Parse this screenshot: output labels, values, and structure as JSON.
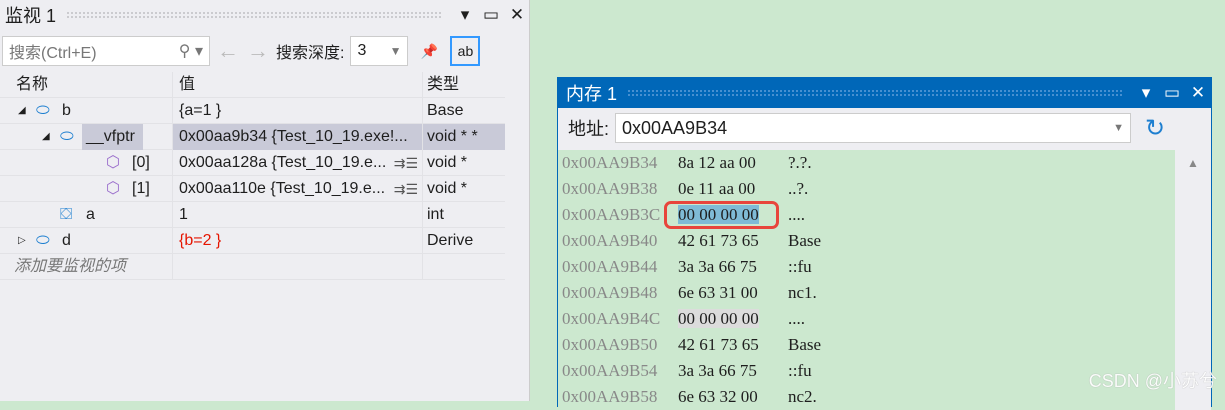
{
  "watch": {
    "title": "监视 1",
    "search_placeholder": "搜索(Ctrl+E)",
    "depth_label": "搜索深度:",
    "depth_value": "3",
    "columns": [
      "名称",
      "值",
      "类型"
    ],
    "rows": [
      {
        "name": "b",
        "value": "{a=1 }",
        "type": "Base",
        "indent": 0,
        "expander": "expanded",
        "icon": "class-icon"
      },
      {
        "name": "__vfptr",
        "value": "0x00aa9b34 {Test_10_19.exe!...",
        "type": "void * *",
        "indent": 1,
        "expander": "expanded",
        "icon": "class-icon",
        "selected": true
      },
      {
        "name": "[0]",
        "value": "0x00aa128a {Test_10_19.e...",
        "type": "void *",
        "indent": 2,
        "icon": "cube-icon",
        "visualizer": true
      },
      {
        "name": "[1]",
        "value": "0x00aa110e {Test_10_19.e...",
        "type": "void *",
        "indent": 2,
        "icon": "cube-icon",
        "visualizer": true
      },
      {
        "name": "a",
        "value": "1",
        "type": "int",
        "indent": 1,
        "icon": "field-icon"
      },
      {
        "name": "d",
        "value": "{b=2 }",
        "type": "Derive",
        "indent": 0,
        "expander": "collapsed",
        "icon": "class-icon",
        "changed": true
      }
    ],
    "add_item": "添加要监视的项"
  },
  "memory": {
    "title": "内存 1",
    "address_label": "地址:",
    "address_value": "0x00AA9B34",
    "rows": [
      {
        "addr": "0x00AA9B34",
        "bytes": "8a 12 aa 00",
        "text": "?.?."
      },
      {
        "addr": "0x00AA9B38",
        "bytes": "0e 11 aa 00",
        "text": "..?."
      },
      {
        "addr": "0x00AA9B3C",
        "bytes": "00 00 00 00",
        "text": "....",
        "highlight": "selected"
      },
      {
        "addr": "0x00AA9B40",
        "bytes": "42 61 73 65",
        "text": "Base"
      },
      {
        "addr": "0x00AA9B44",
        "bytes": "3a 3a 66 75",
        "text": "::fu"
      },
      {
        "addr": "0x00AA9B48",
        "bytes": "6e 63 31 00",
        "text": "nc1."
      },
      {
        "addr": "0x00AA9B4C",
        "bytes": "00 00 00 00",
        "text": "....",
        "highlight": "gray"
      },
      {
        "addr": "0x00AA9B50",
        "bytes": "42 61 73 65",
        "text": "Base"
      },
      {
        "addr": "0x00AA9B54",
        "bytes": "3a 3a 66 75",
        "text": "::fu"
      },
      {
        "addr": "0x00AA9B58",
        "bytes": "6e 63 32 00",
        "text": "nc2."
      }
    ]
  },
  "watermark": "CSDN @小苏兮"
}
